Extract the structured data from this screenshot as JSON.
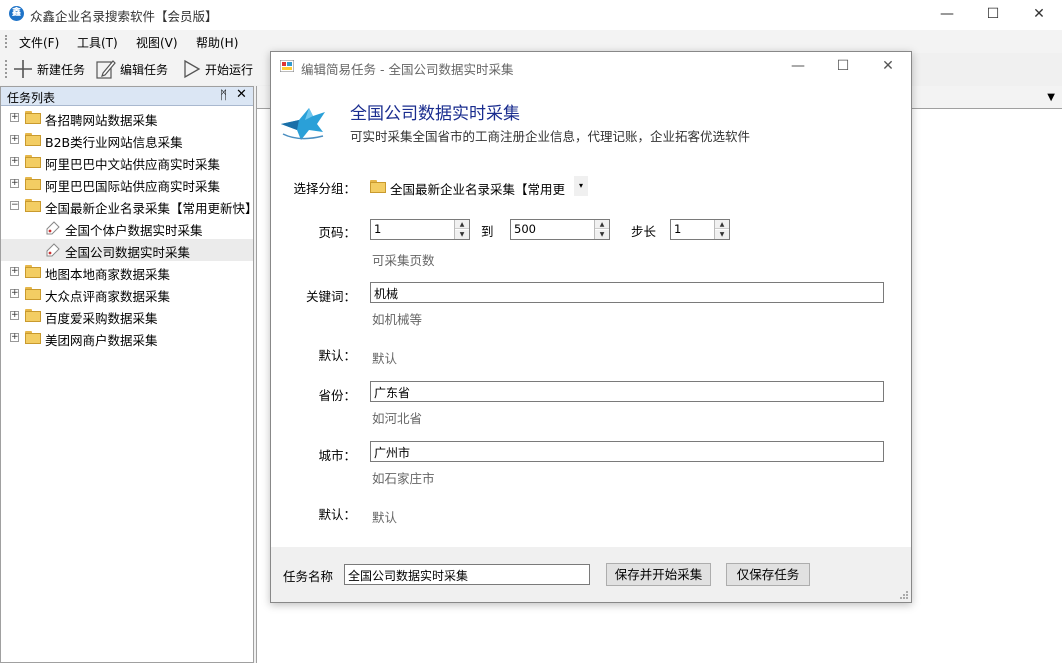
{
  "app": {
    "icon_glyph": "鑫",
    "title": "众鑫企业名录搜索软件【会员版】",
    "accent_color": "#1e73c8"
  },
  "window_controls": {
    "minimize": "—",
    "maximize": "☐",
    "close": "✕"
  },
  "menu": [
    {
      "label": "文件(F)"
    },
    {
      "label": "工具(T)"
    },
    {
      "label": "视图(V)"
    },
    {
      "label": "帮助(H)"
    }
  ],
  "toolbar": [
    {
      "label": "新建任务",
      "icon": "plus-icon"
    },
    {
      "label": "编辑任务",
      "icon": "edit-icon"
    },
    {
      "label": "开始运行",
      "icon": "play-icon"
    }
  ],
  "panel": {
    "title": "任务列表",
    "pin": "ᛗ",
    "close": "✕",
    "tree": [
      {
        "label": "各招聘网站数据采集",
        "type": "folder",
        "expander": "+"
      },
      {
        "label": "B2B类行业网站信息采集",
        "type": "folder",
        "expander": "+"
      },
      {
        "label": "阿里巴巴中文站供应商实时采集",
        "type": "folder",
        "expander": "+"
      },
      {
        "label": "阿里巴巴国际站供应商实时采集",
        "type": "folder",
        "expander": "+"
      },
      {
        "label": "全国最新企业名录采集【常用更新快】",
        "type": "folder",
        "expander": "−"
      },
      {
        "label": "全国个体户数据实时采集",
        "type": "task"
      },
      {
        "label": "全国公司数据实时采集",
        "type": "task",
        "selected": true
      },
      {
        "label": "地图本地商家数据采集",
        "type": "folder",
        "expander": "+"
      },
      {
        "label": "大众点评商家数据采集",
        "type": "folder",
        "expander": "+"
      },
      {
        "label": "百度爱采购数据采集",
        "type": "folder",
        "expander": "+"
      },
      {
        "label": "美团网商户数据采集",
        "type": "folder",
        "expander": "+"
      }
    ]
  },
  "dialog": {
    "title": "编辑简易任务 - 全国公司数据实时采集",
    "header_title": "全国公司数据实时采集",
    "header_subtitle": "可实时采集全国省市的工商注册企业信息，代理记账，企业拓客优选软件",
    "group_label": "选择分组：",
    "group_value": "全国最新企业名录采集【常用更",
    "page_label": "页码：",
    "page_from": "1",
    "page_to_label": "到",
    "page_to": "500",
    "step_label": "步长",
    "step_value": "1",
    "page_hint": "可采集页数",
    "keyword_label": "关键词：",
    "keyword_value": "机械",
    "keyword_hint": "如机械等",
    "default1_label": "默认：",
    "default1_hint": "默认",
    "province_label": "省份：",
    "province_value": "广东省",
    "province_hint": "如河北省",
    "city_label": "城市：",
    "city_value": "广州市",
    "city_hint": "如石家庄市",
    "default2_label": "默认：",
    "default2_hint": "默认",
    "task_name_label": "任务名称",
    "task_name_value": "全国公司数据实时采集",
    "save_start_button": "保存并开始采集",
    "save_only_button": "仅保存任务",
    "title_color": "#1a2d8f"
  }
}
